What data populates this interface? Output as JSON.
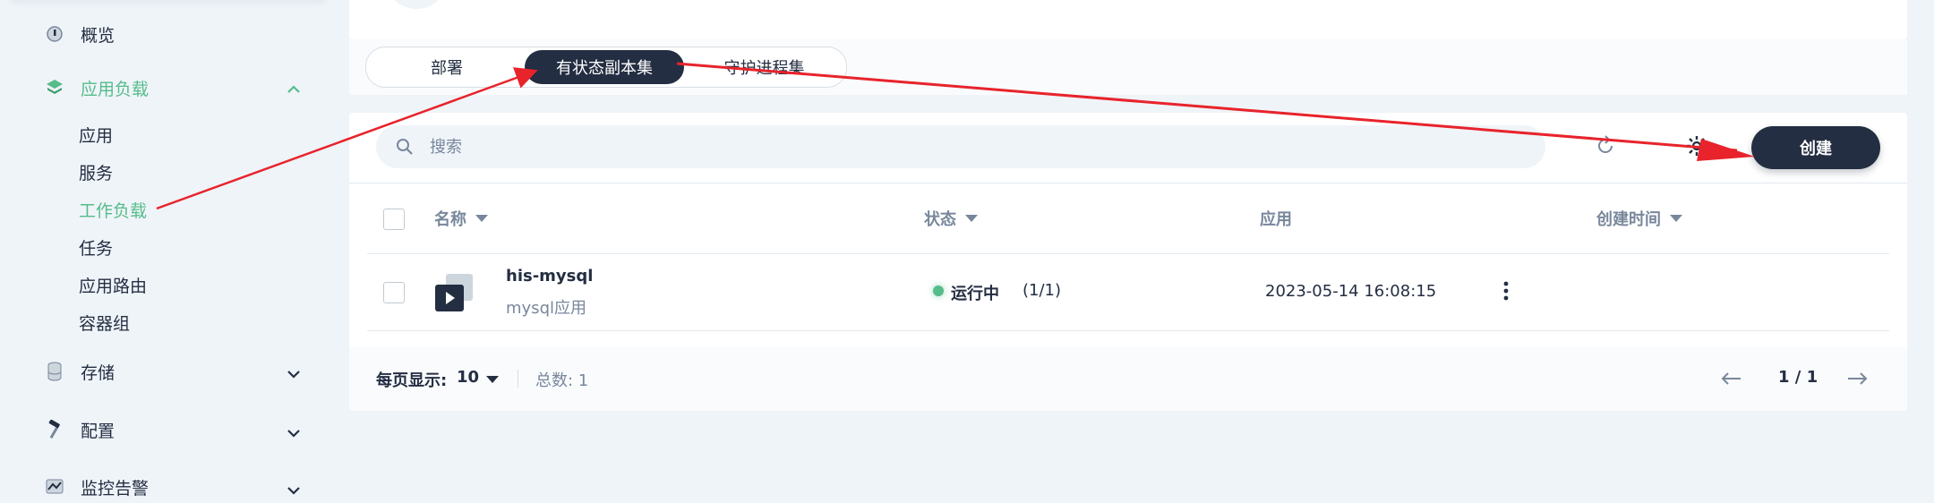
{
  "sidebar": {
    "overview": "概览",
    "workloads_group": "应用负载",
    "sub_items": [
      "应用",
      "服务",
      "工作负载",
      "任务",
      "应用路由",
      "容器组"
    ],
    "storage": "存储",
    "config": "配置",
    "monitoring": "监控告警"
  },
  "tabs": [
    "部署",
    "有状态副本集",
    "守护进程集"
  ],
  "toolbar": {
    "search_placeholder": "搜索",
    "create_label": "创建"
  },
  "table": {
    "columns": [
      "名称",
      "状态",
      "应用",
      "创建时间"
    ],
    "rows": [
      {
        "name": "his-mysql",
        "description": "mysql应用",
        "status": "运行中",
        "replicas": "(1/1)",
        "app": "",
        "created": "2023-05-14 16:08:15"
      }
    ]
  },
  "pagination": {
    "per_page_label": "每页显示:",
    "per_page_value": "10",
    "total": "总数: 1",
    "page": "1 / 1"
  },
  "colors": {
    "accent": "#55bc8a",
    "dark": "#242e42",
    "annotation_arrow": "#e8232b"
  },
  "annotations": [
    "arrow from 工作负载 to 有状态副本集",
    "arrow from 有状态副本集 to 创建"
  ]
}
